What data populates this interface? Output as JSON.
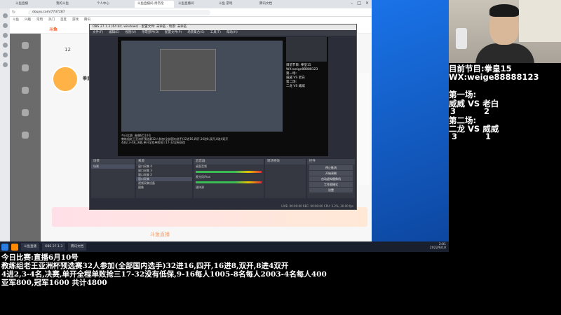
{
  "browser": {
    "tabs": [
      "斗鱼直播",
      "我的斗鱼",
      "个人中心",
      "斗鱼直播间-周杰伦",
      "斗鱼直播间",
      "斗鱼 游戏",
      "腾讯文档"
    ],
    "url": "douyu.com/7737287",
    "bookmarks": [
      "斗鱼",
      "兴趣",
      "常用",
      "热门",
      "百度",
      "游戏",
      "腾讯"
    ]
  },
  "douyu_page": {
    "logo": "斗鱼",
    "room_number": "12",
    "room_title": "拳皇好",
    "footer_text": "斗鱼直播"
  },
  "obs": {
    "title": "OBS 27.1.3 (64 bit, windows) - 配置文件: 未命名 - 场景: 未命名",
    "menu": [
      "文件(F)",
      "编辑(E)",
      "视图(V)",
      "停靠部件(D)",
      "配置文件(P)",
      "场景集合(S)",
      "工具(T)",
      "帮助(H)"
    ],
    "preview_cam_text": "目前节目: 拳皇15\nWX:weige88888123\n第一场:\n威威 VS 老白\n第二场:\n二龙 VS 威威",
    "preview_bottom_text": "今日比赛: 直播6月10号\n教练组老王亚洲杯预选赛32人参加(全部国内选手)32进16,四开,16进8,双开,8进4双开\n4进2,3-4名,决赛,单开全程单败抢三17-32没有低保",
    "docks": {
      "scenes": {
        "title": "场景",
        "items": [
          "场景"
        ]
      },
      "sources": {
        "title": "来源",
        "items": [
          "窗口采集 4",
          "窗口采集 3",
          "窗口采集 2",
          "窗口采集",
          "视频采集设备",
          "图像"
        ]
      },
      "mixer": {
        "title": "混音器",
        "items": [
          "桌面音频",
          "麦克风/Aux",
          "媒体源"
        ]
      },
      "transitions": {
        "title": "转场特效"
      },
      "controls": {
        "title": "控件",
        "buttons": [
          "停止推流",
          "开始录制",
          "启动虚拟摄像机",
          "工作室模式",
          "设置",
          "退出"
        ]
      }
    },
    "status": "LIVE: 00:00:00  REC: 00:00:00  CPU: 3.2%, 30.00 fps"
  },
  "taskbar": {
    "buttons": [
      "斗鱼直播",
      "OBS 27.1.3",
      "腾讯文档"
    ],
    "clock": "2:01\n2022/6/10"
  },
  "overlay": {
    "current_show": "目前节目:拳皇15",
    "wx": "WX:weige88888123",
    "match1_label": "第一场:",
    "match1_players": "威威 VS 老白",
    "match1_score": "3          2",
    "match2_label": "第二场:",
    "match2_players": "二龙 VS 威威",
    "match2_score": "3          1"
  },
  "bottom_info": {
    "line1": "今日比赛:直播6月10号",
    "line2": "教练组老王亚洲杯预选赛32人参加(全部国内选手)32进16,四开,16进8,双开,8进4双开",
    "line3": "4进2,3-4名,决赛,单开全程单败抢三17-32没有低保,9-16每人1005-8名每人2003-4名每人400",
    "line4": "亚军800,冠军1600 共计4800"
  }
}
